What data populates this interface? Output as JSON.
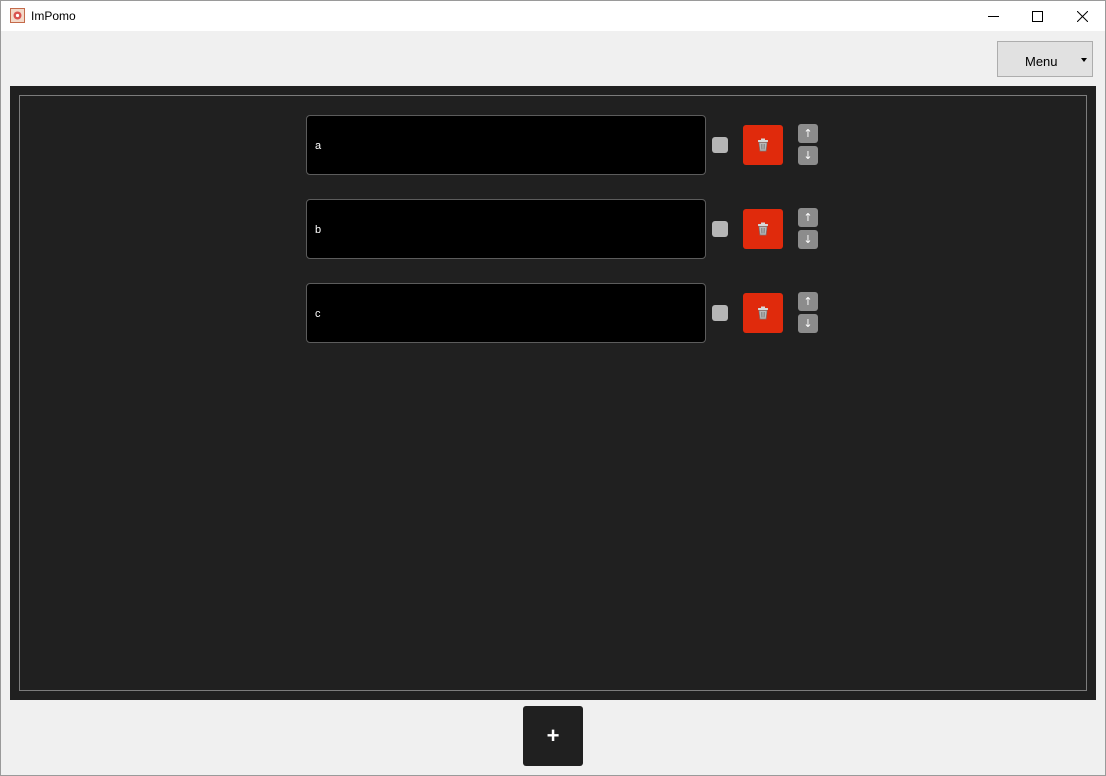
{
  "window": {
    "title": "ImPomo",
    "controls": {
      "minimize_icon": "minimize-icon",
      "maximize_icon": "maximize-icon",
      "close_icon": "close-icon"
    }
  },
  "menu": {
    "label": "Menu",
    "caret_icon": "caret-down-icon"
  },
  "tasks": [
    {
      "text": "a",
      "checked": false,
      "delete_icon": "trash-icon",
      "up_label": "↑",
      "down_label": "↓"
    },
    {
      "text": "b",
      "checked": false,
      "delete_icon": "trash-icon",
      "up_label": "↑",
      "down_label": "↓"
    },
    {
      "text": "c",
      "checked": false,
      "delete_icon": "trash-icon",
      "up_label": "↑",
      "down_label": "↓"
    }
  ],
  "add_button": {
    "label": "+"
  },
  "colors": {
    "panel_bg": "#202020",
    "input_bg": "#000000",
    "delete_bg": "#e02a0c",
    "arrow_bg": "#8c8c8c",
    "checkbox_bg": "#b5b5b5"
  }
}
